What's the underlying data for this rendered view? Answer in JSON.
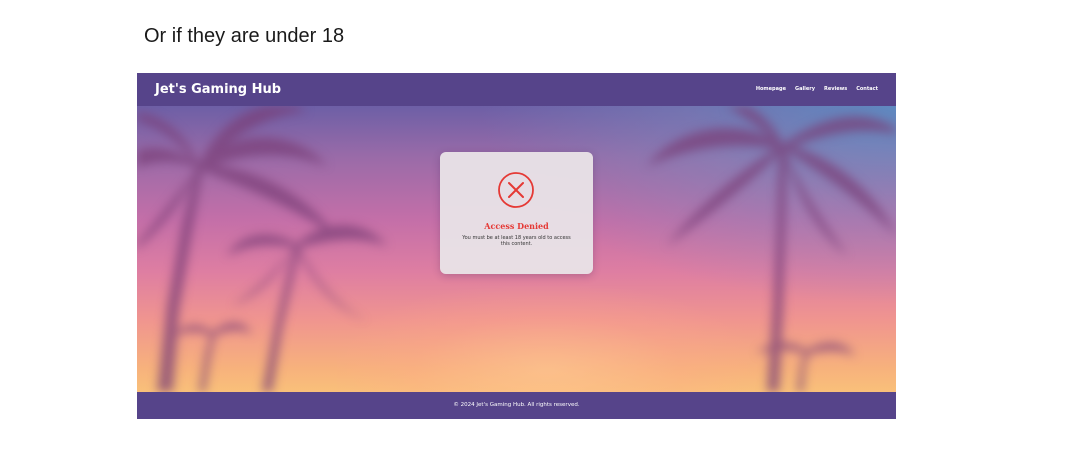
{
  "caption": "Or if they are under 18",
  "header": {
    "brand": "Jet's Gaming Hub",
    "nav": [
      {
        "label": "Homepage"
      },
      {
        "label": "Gallery"
      },
      {
        "label": "Reviews"
      },
      {
        "label": "Contact"
      }
    ]
  },
  "modal": {
    "icon": "x-circle-icon",
    "title": "Access Denied",
    "message": "You must be at least 18 years old to access this content."
  },
  "footer": {
    "text": "© 2024 Jet's Gaming Hub. All rights reserved."
  },
  "colors": {
    "header_bg": "#56448a",
    "footer_bg": "#56448a",
    "error": "#e53935",
    "modal_bg": "#e8e2e6"
  }
}
